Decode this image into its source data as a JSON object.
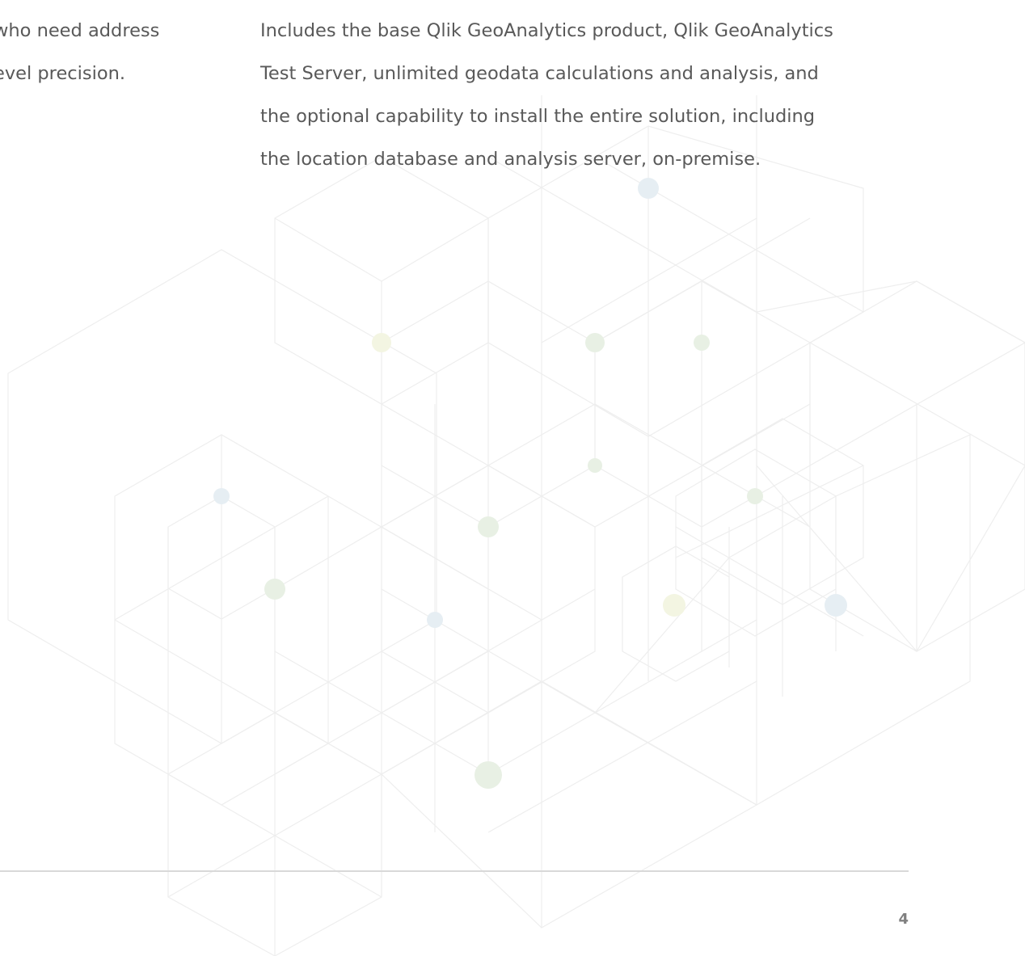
{
  "left_column": {
    "lines": [
      "who need address",
      "evel precision."
    ]
  },
  "right_column": {
    "lines": [
      "Includes the base Qlik GeoAnalytics product, Qlik GeoAnalytics",
      "Test Server, unlimited geodata calculations and analysis, and",
      "the optional capability to install the entire solution, including",
      "the location database and analysis server, on-premise."
    ]
  },
  "footer": {
    "page_number": "4"
  },
  "colors": {
    "body_text": "#595959",
    "pattern_line": "#eeeeee",
    "node_green": "#e8f0e4",
    "node_blue": "#e6eef3",
    "node_yellow": "#f3f5e2",
    "rule": "#d9d9d9",
    "page_number": "#808080"
  }
}
